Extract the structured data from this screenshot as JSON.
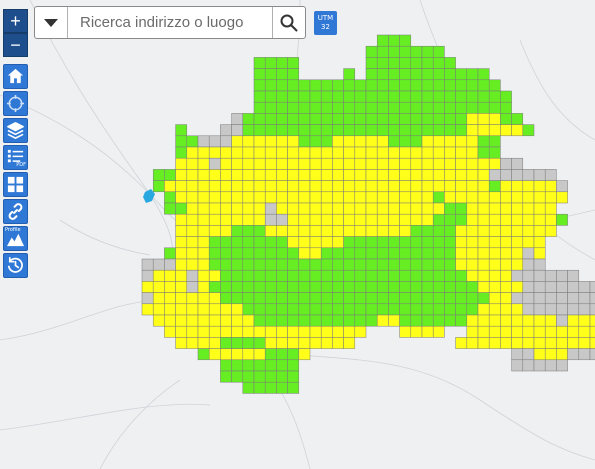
{
  "search": {
    "placeholder": "Ricerca indirizzo o luogo"
  },
  "zoom": {
    "in_label": "+",
    "out_label": "−"
  },
  "crs": {
    "line1": "UTM",
    "line2": "32"
  },
  "toolbar": {
    "tools": [
      {
        "name": "home-icon"
      },
      {
        "name": "locate-icon"
      },
      {
        "name": "layers-icon"
      },
      {
        "name": "legend-pdf-icon",
        "tag": "PDF"
      },
      {
        "name": "grid-layout-icon"
      },
      {
        "name": "link-icon"
      },
      {
        "name": "profile-icon",
        "tag": "Profile"
      },
      {
        "name": "history-icon"
      }
    ]
  },
  "colors": {
    "green": "#66ee22",
    "yellow": "#ffff1a",
    "gray": "#c8c8c8",
    "water": "#29a8e0",
    "toolbar_blue": "#2f78d6",
    "zoom_blue": "#1e4f8c"
  },
  "legend_classes": [
    "green",
    "yellow",
    "gray"
  ]
}
